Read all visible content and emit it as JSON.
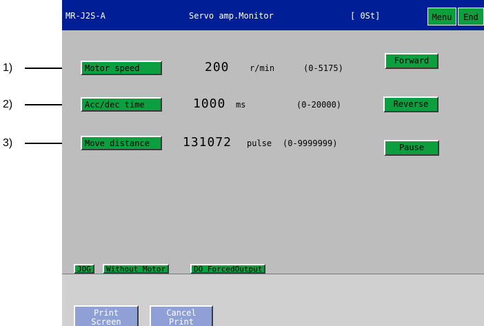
{
  "callouts": [
    "1)",
    "2)",
    "3)"
  ],
  "titlebar": {
    "model": "MR-J2S-A",
    "title": "Servo amp.Monitor",
    "station": "[ 0St]",
    "menu_label": "Menu",
    "end_label": "End"
  },
  "fields": [
    {
      "label": "Motor speed",
      "value": "200",
      "unit": "r/min",
      "range": "(0-5175)"
    },
    {
      "label": "Acc/dec time",
      "value": "1000",
      "unit": "ms",
      "range": "(0-20000)"
    },
    {
      "label": "Move distance",
      "value": "131072",
      "unit": "pulse",
      "range": "(0-9999999)"
    }
  ],
  "controls": {
    "forward_label": "Forward",
    "reverse_label": "Reverse",
    "pause_label": "Pause"
  },
  "tabs": [
    "JOG",
    "Without Motor",
    "DO ForcedOutput"
  ],
  "bottom": {
    "print_screen_label": "Print\nScreen",
    "cancel_print_label": "Cancel\nPrint"
  },
  "colors": {
    "titlebar": "#001e96",
    "button_green": "#0c9e3f",
    "screen_bg": "#bdbdbd",
    "print_button": "#8fa0d6"
  }
}
